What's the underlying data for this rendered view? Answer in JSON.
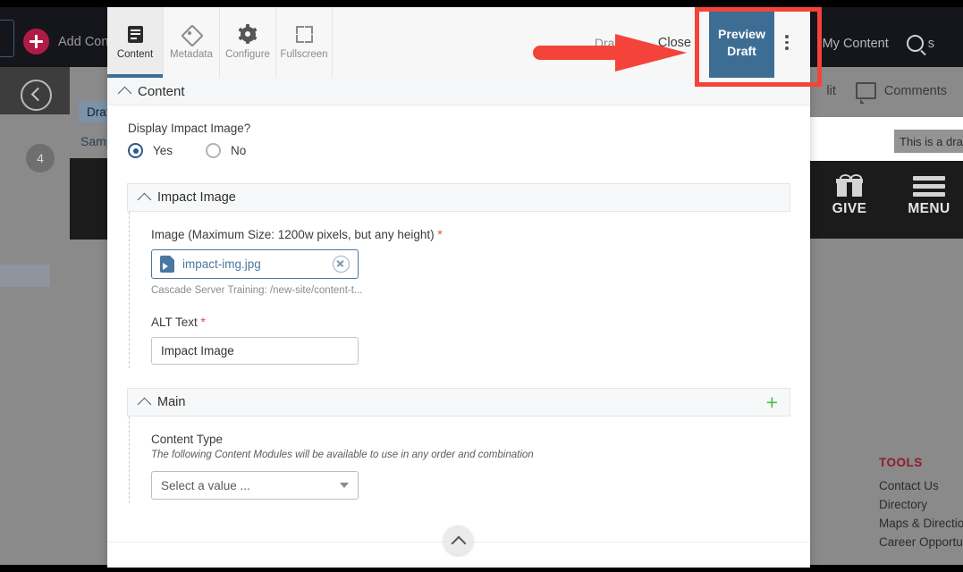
{
  "background_app": {
    "topbar": {
      "add_content_label": "Add Content",
      "add_content_icon": "plus-circle-icon",
      "my_content_label": "My Content",
      "search_icon": "search-icon",
      "search_ghost": "s"
    },
    "subbar": {
      "edit_label": "lit",
      "comments_label": "Comments",
      "comments_icon": "comment-bubble-icon"
    },
    "left_rail": {
      "collapse_icon": "chevron-left-circle-icon",
      "badge_count": "4"
    },
    "tree": {
      "draft_label": "Draft",
      "sample_label": "Samp"
    },
    "site_preview": {
      "draft_banner": "This is a draf",
      "give_label": "GIVE",
      "give_icon": "gift-icon",
      "menu_label": "MENU",
      "menu_icon": "hamburger-icon",
      "tools_heading": "TOOLS",
      "tools_links": [
        "Contact Us",
        "Directory",
        "Maps & Direction",
        "Career Opportuni"
      ],
      "tools_heading_color": "#8e1c2c"
    }
  },
  "modal": {
    "tabs": [
      {
        "label": "Content",
        "icon": "document-lines-icon",
        "active": true
      },
      {
        "label": "Metadata",
        "icon": "tag-icon",
        "active": false
      },
      {
        "label": "Configure",
        "icon": "gear-icon",
        "active": false
      },
      {
        "label": "Fullscreen",
        "icon": "fullscreen-icon",
        "active": false
      }
    ],
    "draft_status": "Draft sa",
    "close_label": "Close",
    "preview_button": {
      "line1": "Preview",
      "line2": "Draft",
      "color": "#3e6d94"
    },
    "kebab_icon": "more-vertical-icon",
    "content_section": {
      "title": "Content",
      "collapse_icon": "chevron-up-icon",
      "display_impact_image": {
        "question": "Display Impact Image?",
        "options": [
          {
            "label": "Yes",
            "selected": true
          },
          {
            "label": "No",
            "selected": false
          }
        ]
      }
    },
    "impact_image_panel": {
      "title": "Impact Image",
      "collapse_icon": "chevron-up-icon",
      "image_field": {
        "label": "Image (Maximum Size: 1200w pixels, but any height)",
        "required_marker": "*",
        "file_name": "impact-img.jpg",
        "file_icon": "image-file-icon",
        "clear_icon": "clear-circle-icon",
        "path": "Cascade Server Training: /new-site/content-t..."
      },
      "alt_text_field": {
        "label": "ALT Text",
        "required_marker": "*",
        "value": "Impact Image"
      }
    },
    "main_panel": {
      "title": "Main",
      "collapse_icon": "chevron-up-icon",
      "add_icon": "plus-icon",
      "add_icon_color": "#4cc24c",
      "content_type": {
        "label": "Content Type",
        "help_text": "The following Content Modules will be available to use in any order and combination",
        "select_value": "Select a value ...",
        "caret_icon": "chevron-down-icon"
      }
    },
    "scroll_up_icon": "chevron-up-circle-icon"
  },
  "annotations": {
    "highlight_color": "#f4433a",
    "box_target": "preview-draft-button",
    "arrow_target": "preview-draft-button"
  }
}
